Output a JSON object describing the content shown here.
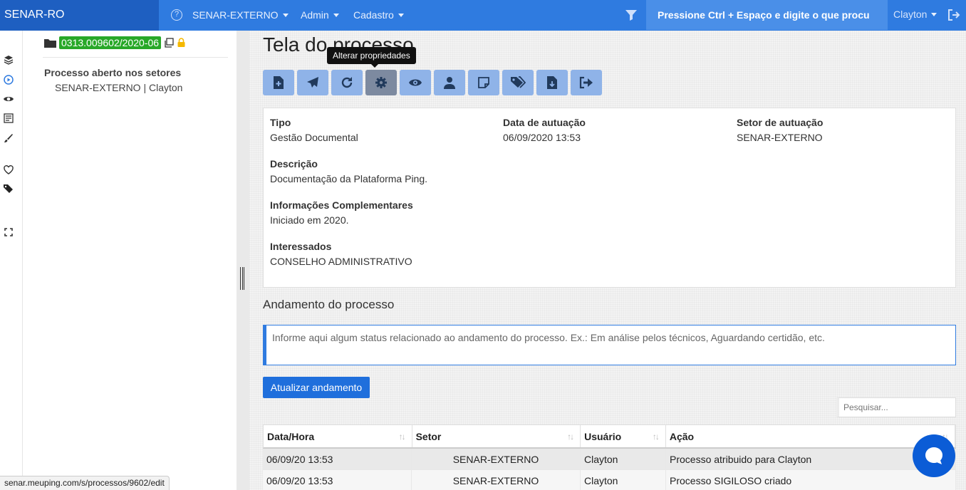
{
  "topbar": {
    "brand": "SENAR-RO",
    "menus": [
      "SENAR-EXTERNO",
      "Admin",
      "Cadastro"
    ],
    "search_placeholder": "Pressione Ctrl + Espaço e digite o que procu",
    "user": "Clayton",
    "colors": {
      "bar": "#2f7be0",
      "brand": "#1e5fc1"
    }
  },
  "sidebar": {
    "process_number": "0313.009602/2020-06",
    "section_title": "Processo aberto nos setores",
    "section_value": "SENAR-EXTERNO | Clayton"
  },
  "iconstrip": [
    "layers-icon",
    "play-circle-icon",
    "eye-icon",
    "newspaper-icon",
    "brush-icon",
    "heart-icon",
    "tags-icon",
    "expand-icon"
  ],
  "main": {
    "title": "Tela do processo",
    "tooltip": "Alterar propriedades",
    "toolbar": [
      "file-plus-icon",
      "paper-plane-icon",
      "redo-icon",
      "gear-icon",
      "eye-icon",
      "user-icon",
      "sticky-note-icon",
      "tags-icon",
      "file-download-icon",
      "sign-out-icon"
    ],
    "details": {
      "tipo_label": "Tipo",
      "tipo_value": "Gestão Documental",
      "data_label": "Data de autuação",
      "data_value": "06/09/2020 13:53",
      "setor_label": "Setor de autuação",
      "setor_value": "SENAR-EXTERNO",
      "descricao_label": "Descrição",
      "descricao_value": "Documentação da Plataforma Ping.",
      "info_label": "Informações Complementares",
      "info_value": "Iniciado em 2020.",
      "interessados_label": "Interessados",
      "interessados_value": "CONSELHO ADMINISTRATIVO"
    },
    "andamento_title": "Andamento do processo",
    "andamento_placeholder": "Informe aqui algum status relacionado ao andamento do processo. Ex.: Em análise pelos técnicos, Aguardando certidão, etc.",
    "update_button": "Atualizar andamento",
    "table_search_placeholder": "Pesquisar...",
    "table": {
      "columns": [
        "Data/Hora",
        "Setor",
        "Usuário",
        "Ação"
      ],
      "rows": [
        [
          "06/09/20 13:53",
          "SENAR-EXTERNO",
          "Clayton",
          "Processo atribuido para Clayton"
        ],
        [
          "06/09/20 13:53",
          "SENAR-EXTERNO",
          "Clayton",
          "Processo SIGILOSO criado"
        ]
      ]
    }
  },
  "statusbar_url": "senar.meuping.com/s/processos/9602/edit"
}
